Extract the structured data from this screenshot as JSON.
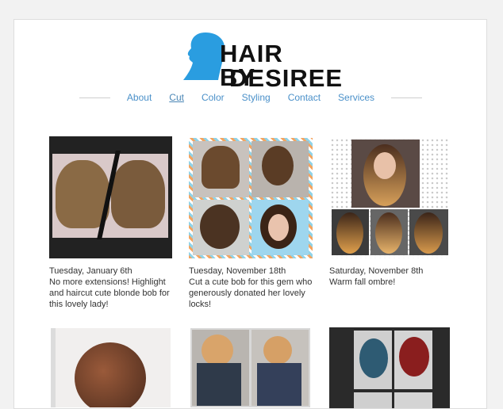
{
  "brand": {
    "line1": "HAIR BY",
    "line2": "DESIREE",
    "accent": "#2a9de0"
  },
  "nav": {
    "items": [
      {
        "label": "About"
      },
      {
        "label": "Cut",
        "active": true
      },
      {
        "label": "Color"
      },
      {
        "label": "Styling"
      },
      {
        "label": "Contact"
      },
      {
        "label": "Services"
      }
    ]
  },
  "posts": [
    {
      "date": "Tuesday, January 6th",
      "text": " No more extensions! Highlight and haircut cute blonde bob for this lovely lady!"
    },
    {
      "date": "Tuesday, November 18th",
      "text": "Cut a cute bob for this gem who generously donated her lovely locks!"
    },
    {
      "date": "Saturday, November 8th",
      "text": "Warm fall ombre!"
    }
  ]
}
